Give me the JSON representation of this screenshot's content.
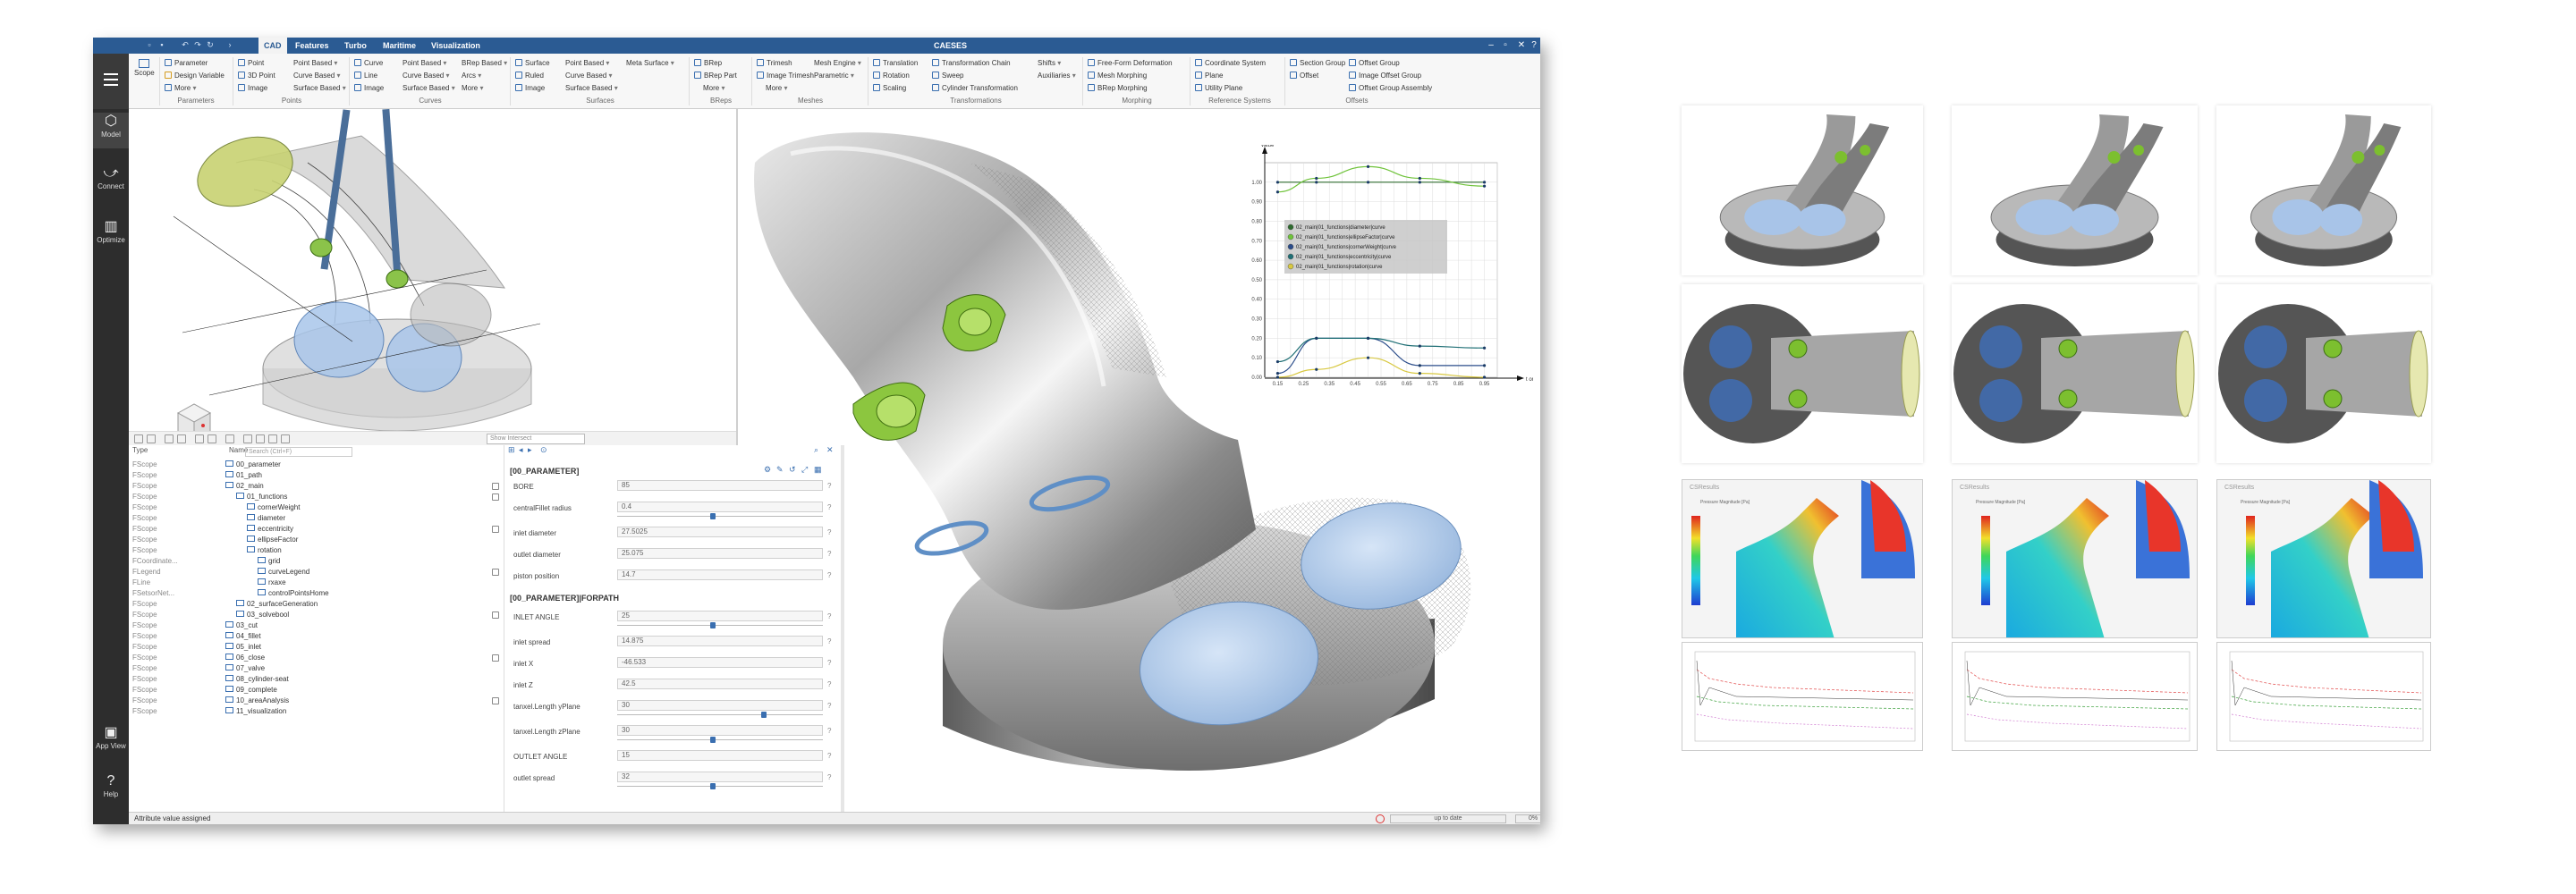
{
  "window": {
    "app_name": "CAESES",
    "tabs": [
      {
        "label": "CAD",
        "active": true
      },
      {
        "label": "Features",
        "active": false
      },
      {
        "label": "Turbo",
        "active": false
      },
      {
        "label": "Maritime",
        "active": false
      },
      {
        "label": "Visualization",
        "active": false
      }
    ]
  },
  "ribbon": {
    "scope": "Scope",
    "parameters": {
      "label": "Parameters",
      "items": [
        "Parameter",
        "Design Variable",
        "More"
      ]
    },
    "points": {
      "label": "Points",
      "items": [
        "Point",
        "3D Point",
        "Image",
        "Point Based",
        "Curve Based",
        "Surface Based"
      ]
    },
    "curves": {
      "label": "Curves",
      "items": [
        "Curve",
        "Line",
        "Image",
        "Point Based",
        "Curve Based",
        "Surface Based",
        "BRep Based",
        "Arcs",
        "More"
      ]
    },
    "surfaces": {
      "label": "Surfaces",
      "items": [
        "Surface",
        "Ruled",
        "Image",
        "Point Based",
        "Curve Based",
        "Surface Based",
        "Meta Surface"
      ]
    },
    "breps": {
      "label": "BReps",
      "items": [
        "BRep",
        "BRep Part",
        "More"
      ]
    },
    "meshes": {
      "label": "Meshes",
      "items": [
        "Trimesh",
        "Image Trimesh",
        "More",
        "Mesh Engine",
        "Parametric"
      ]
    },
    "transformations": {
      "label": "Transformations",
      "items": [
        "Translation",
        "Rotation",
        "Scaling",
        "Transformation Chain",
        "Sweep",
        "Cylinder Transformation",
        "Shifts",
        "Auxiliaries"
      ]
    },
    "morphing": {
      "label": "Morphing",
      "items": [
        "Free-Form Deformation",
        "Mesh Morphing",
        "BRep Morphing"
      ]
    },
    "reference": {
      "label": "Reference Systems",
      "items": [
        "Coordinate System",
        "Plane",
        "Utility Plane"
      ]
    },
    "offsets": {
      "label": "Offsets",
      "items": [
        "Section Group",
        "Offset",
        "Offset Group",
        "Image Offset Group",
        "Offset Group Assembly"
      ]
    }
  },
  "sidebar": {
    "items": [
      {
        "label": "Model",
        "icon": "cube-icon",
        "active": true
      },
      {
        "label": "Connect",
        "icon": "connect-icon",
        "active": false
      },
      {
        "label": "Optimize",
        "icon": "chart-icon",
        "active": false
      },
      {
        "label": "App View",
        "icon": "app-icon",
        "active": false
      },
      {
        "label": "Help",
        "icon": "help-icon",
        "active": false
      }
    ]
  },
  "viewport_toolbar": {
    "filter_placeholder": "Show Intersect"
  },
  "tree": {
    "headers": {
      "type": "Type",
      "name": "Name"
    },
    "search_placeholder": "Search (Ctrl+F)",
    "rows": [
      {
        "type": "FScope",
        "name": "00_parameter",
        "indent": 1
      },
      {
        "type": "FScope",
        "name": "01_path",
        "indent": 1
      },
      {
        "type": "FScope",
        "name": "02_main",
        "indent": 1
      },
      {
        "type": "FScope",
        "name": "01_functions",
        "indent": 2
      },
      {
        "type": "FScope",
        "name": "cornerWeight",
        "indent": 3
      },
      {
        "type": "FScope",
        "name": "diameter",
        "indent": 3
      },
      {
        "type": "FScope",
        "name": "eccentricity",
        "indent": 3
      },
      {
        "type": "FScope",
        "name": "ellipseFactor",
        "indent": 3
      },
      {
        "type": "FScope",
        "name": "rotation",
        "indent": 3
      },
      {
        "type": "FCoordinate...",
        "name": "grid",
        "indent": 4
      },
      {
        "type": "FLegend",
        "name": "curveLegend",
        "indent": 4
      },
      {
        "type": "FLine",
        "name": "rxaxe",
        "indent": 4
      },
      {
        "type": "FSetsorNet...",
        "name": "controlPointsHome",
        "indent": 4
      },
      {
        "type": "FScope",
        "name": "02_surfaceGeneration",
        "indent": 2
      },
      {
        "type": "FScope",
        "name": "03_solvebool",
        "indent": 2
      },
      {
        "type": "FScope",
        "name": "03_cut",
        "indent": 1
      },
      {
        "type": "FScope",
        "name": "04_fillet",
        "indent": 1
      },
      {
        "type": "FScope",
        "name": "05_inlet",
        "indent": 1
      },
      {
        "type": "FScope",
        "name": "06_close",
        "indent": 1
      },
      {
        "type": "FScope",
        "name": "07_valve",
        "indent": 1
      },
      {
        "type": "FScope",
        "name": "08_cylinder-seat",
        "indent": 1
      },
      {
        "type": "FScope",
        "name": "09_complete",
        "indent": 1
      },
      {
        "type": "FScope",
        "name": "10_areaAnalysis",
        "indent": 1
      },
      {
        "type": "FScope",
        "name": "11_visualization",
        "indent": 1
      }
    ]
  },
  "params": {
    "section1": "[00_PARAMETER]",
    "section2": "[00_PARAMETER]|FORPATH",
    "rows": [
      {
        "label": "BORE",
        "value": "85",
        "slider": false
      },
      {
        "label": "centralFillet radius",
        "value": "0.4",
        "slider": true,
        "pos": 0.45
      },
      {
        "label": "inlet diameter",
        "value": "27.5025",
        "slider": false
      },
      {
        "label": "outlet diameter",
        "value": "25.075",
        "slider": false
      },
      {
        "label": "piston position",
        "value": "14.7",
        "slider": false
      },
      {
        "label": "INLET ANGLE",
        "value": "25",
        "slider": true,
        "pos": 0.45
      },
      {
        "label": "inlet spread",
        "value": "14.875",
        "slider": false
      },
      {
        "label": "inlet X",
        "value": "-46.533",
        "slider": false
      },
      {
        "label": "inlet Z",
        "value": "42.5",
        "slider": false
      },
      {
        "label": "tanxel.Length yPlane",
        "value": "30",
        "slider": true,
        "pos": 0.7
      },
      {
        "label": "tanxel.Length zPlane",
        "value": "30",
        "slider": true,
        "pos": 0.45
      },
      {
        "label": "OUTLET ANGLE",
        "value": "15",
        "slider": false
      },
      {
        "label": "outlet spread",
        "value": "32",
        "slider": true,
        "pos": 0.45
      }
    ]
  },
  "status": {
    "message": "Attribute value assigned",
    "state": "up to date",
    "zoom": "0%"
  },
  "chart_data": {
    "type": "line",
    "ylabel": "value",
    "xlabel": "t on Path",
    "xticks": [
      "0.15",
      "0.20",
      "0.25",
      "0.30",
      "0.35",
      "0.40",
      "0.45",
      "0.50",
      "0.55",
      "0.60",
      "0.65",
      "0.70",
      "0.75",
      "0.80",
      "0.85",
      "0.90",
      "0.95",
      "1.00"
    ],
    "yticks": [
      "0.00",
      "0.10",
      "0.20",
      "0.30",
      "0.40",
      "0.50",
      "0.60",
      "0.70",
      "0.80",
      "0.90",
      "1.00"
    ],
    "xlim": [
      0.1,
      1.0
    ],
    "ylim": [
      0,
      1.1
    ],
    "grid": true,
    "legend_position": "center",
    "series": [
      {
        "name": "02_main|01_functions|diameter|curve",
        "color": "#2e6b2e",
        "x": [
          0.15,
          0.3,
          0.5,
          0.7,
          0.95
        ],
        "y": [
          1.0,
          1.0,
          1.0,
          1.0,
          1.0
        ]
      },
      {
        "name": "02_main|01_functions|ellipseFactor|curve",
        "color": "#6fc33a",
        "x": [
          0.15,
          0.3,
          0.5,
          0.7,
          0.95
        ],
        "y": [
          0.95,
          1.02,
          1.08,
          1.02,
          0.98
        ]
      },
      {
        "name": "02_main|01_functions|cornerWeight|curve",
        "color": "#2a4c8a",
        "x": [
          0.15,
          0.3,
          0.5,
          0.7,
          0.95
        ],
        "y": [
          0.02,
          0.2,
          0.2,
          0.06,
          0.06
        ]
      },
      {
        "name": "02_main|01_functions|eccentricity|curve",
        "color": "#1f6f75",
        "x": [
          0.15,
          0.3,
          0.5,
          0.7,
          0.95
        ],
        "y": [
          0.08,
          0.2,
          0.2,
          0.16,
          0.15
        ]
      },
      {
        "name": "02_main|01_functions|rotation|curve",
        "color": "#d8c840",
        "x": [
          0.15,
          0.3,
          0.5,
          0.7,
          0.95
        ],
        "y": [
          0.0,
          0.04,
          0.1,
          0.02,
          0.0
        ]
      }
    ]
  },
  "gallery": {
    "colorbar_label": "Pressure Magnitude [Pa]",
    "flow_title": "CSResults"
  },
  "colors": {
    "titlebar": "#2b5b93",
    "sidebar": "#2d2d2d",
    "accent": "#3a6fb0"
  }
}
